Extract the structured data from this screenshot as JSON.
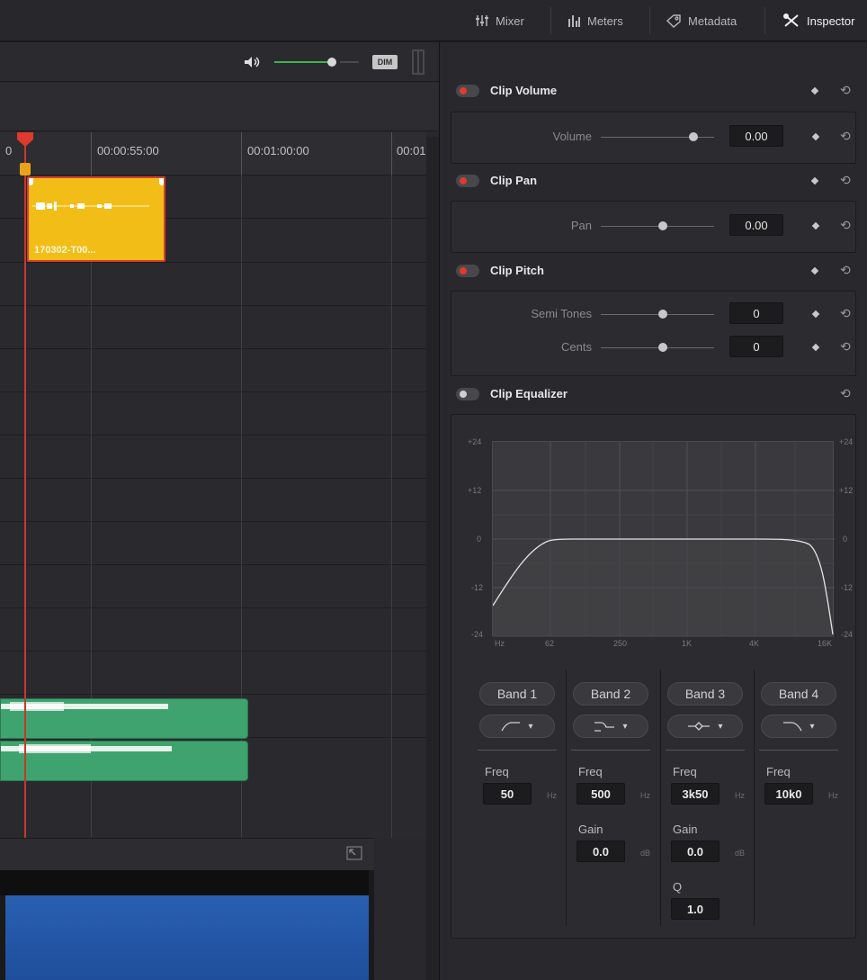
{
  "topbar": {
    "tabs": [
      {
        "label": "Mixer",
        "icon": "mixer-icon"
      },
      {
        "label": "Meters",
        "icon": "meters-icon"
      },
      {
        "label": "Metadata",
        "icon": "metadata-icon"
      },
      {
        "label": "Inspector",
        "icon": "inspector-icon"
      }
    ]
  },
  "timeline": {
    "monitor": {
      "volume_level": 0.7,
      "dim_label": "DIM"
    },
    "ruler": [
      "0",
      "00:00:55:00",
      "00:01:00:00",
      "00:01:"
    ],
    "clip": {
      "name": "170302-T00...",
      "color": "#f2bd16"
    },
    "audio_color": "#3fa36f"
  },
  "inspector": {
    "clip_volume": {
      "title": "Clip Volume",
      "param": "Volume",
      "value": "0.00"
    },
    "clip_pan": {
      "title": "Clip Pan",
      "param": "Pan",
      "value": "0.00"
    },
    "clip_pitch": {
      "title": "Clip Pitch",
      "semitones_label": "Semi Tones",
      "semitones_value": "0",
      "cents_label": "Cents",
      "cents_value": "0"
    },
    "clip_eq": {
      "title": "Clip Equalizer",
      "y_ticks": [
        "+24",
        "+12",
        "0",
        "-12",
        "-24"
      ],
      "x_ticks": [
        "Hz",
        "62",
        "250",
        "1K",
        "4K",
        "16K"
      ],
      "bands": [
        {
          "label": "Band 1",
          "freq_label": "Freq",
          "freq": "50",
          "freq_unit": "Hz"
        },
        {
          "label": "Band 2",
          "freq_label": "Freq",
          "freq": "500",
          "freq_unit": "Hz",
          "gain_label": "Gain",
          "gain": "0.0",
          "gain_unit": "dB"
        },
        {
          "label": "Band 3",
          "freq_label": "Freq",
          "freq": "3k50",
          "freq_unit": "Hz",
          "gain_label": "Gain",
          "gain": "0.0",
          "gain_unit": "dB",
          "q_label": "Q",
          "q": "1.0"
        },
        {
          "label": "Band 4",
          "freq_label": "Freq",
          "freq": "10k0",
          "freq_unit": "Hz"
        }
      ]
    },
    "accent_red": "#e0392e"
  }
}
